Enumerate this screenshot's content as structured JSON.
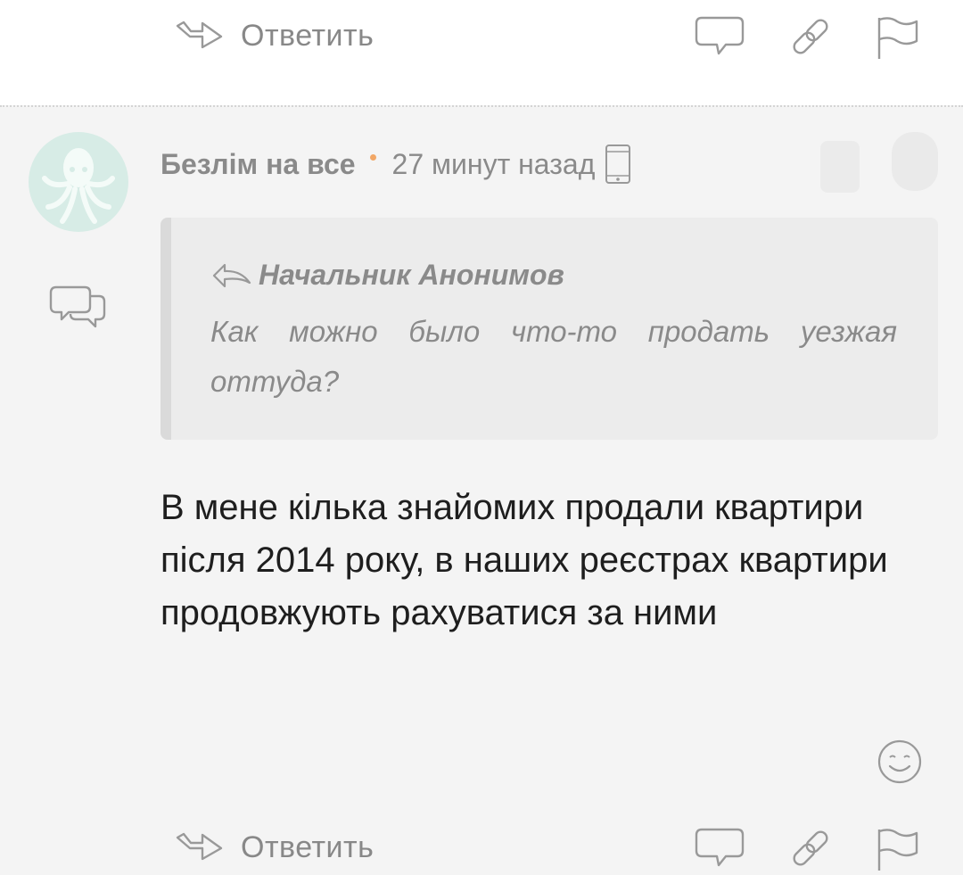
{
  "top_actions": {
    "reply_label": "Ответить"
  },
  "comment": {
    "author": "Безлім на все",
    "time": "27 минут назад",
    "quote": {
      "author": "Начальник Анонимов",
      "text": "Как можно было что-то продать уезжая оттуда?"
    },
    "body": "В мене кілька знайомих продали квартири після 2014 року, в наших реєстрах квартири продовжують рахуватися за ними"
  },
  "bottom_actions": {
    "reply_label": "Ответить"
  },
  "icons": [
    "reply-arrow-icon",
    "comment-icon",
    "link-icon",
    "flag-icon",
    "octopus-avatar-icon",
    "threads-icon",
    "mobile-phone-icon",
    "emoji-icon"
  ],
  "colors": {
    "accent_dot": "#f2a766",
    "muted_text": "#8a8a8a",
    "body_text": "#1e1e1e",
    "background": "#f4f4f4",
    "quote_bg": "#ececec",
    "avatar_bg": "#d7ece6"
  }
}
